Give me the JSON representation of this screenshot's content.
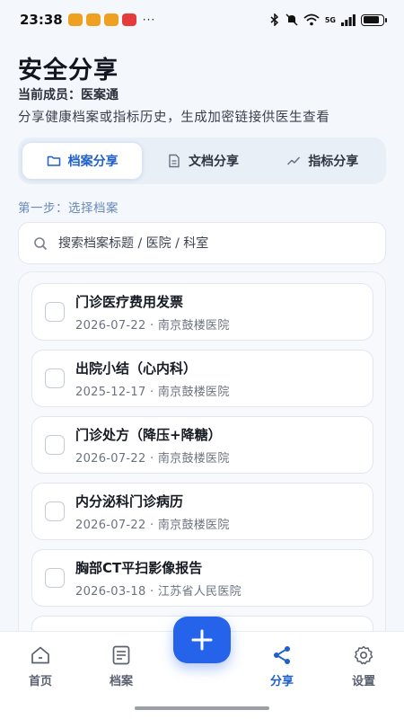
{
  "status_bar": {
    "time": "23:38",
    "more": "···",
    "signal_label": "5G",
    "battery_level": 0.85,
    "app_badges": [
      "#f0a020",
      "#f0a020",
      "#f0a020",
      "#e63b3b"
    ]
  },
  "header": {
    "title": "安全分享",
    "member_line": "当前成员：医案通",
    "subtitle": "分享健康档案或指标历史，生成加密链接供医生查看"
  },
  "tabs": [
    {
      "label": "档案分享",
      "icon": "folder-icon",
      "active": true
    },
    {
      "label": "文档分享",
      "icon": "document-icon",
      "active": false
    },
    {
      "label": "指标分享",
      "icon": "trend-icon",
      "active": false
    }
  ],
  "step_label": "第一步：选择档案",
  "search": {
    "placeholder": "搜索档案标题 / 医院 / 科室",
    "value": ""
  },
  "records": [
    {
      "title": "门诊医疗费用发票",
      "meta": "2026-07-22 · 南京鼓楼医院",
      "checked": false
    },
    {
      "title": "出院小结（心内科）",
      "meta": "2025-12-17 · 南京鼓楼医院",
      "checked": false
    },
    {
      "title": "门诊处方（降压+降糖）",
      "meta": "2026-07-22 · 南京鼓楼医院",
      "checked": false
    },
    {
      "title": "内分泌科门诊病历",
      "meta": "2026-07-22 · 南京鼓楼医院",
      "checked": false
    },
    {
      "title": "胸部CT平扫影像报告",
      "meta": "2026-03-18 · 江苏省人民医院",
      "checked": false
    },
    {
      "title": "",
      "meta": "",
      "checked": false
    }
  ],
  "fab": {
    "label": "+",
    "icon": "plus-icon"
  },
  "nav": [
    {
      "label": "首页",
      "icon": "home-icon",
      "active": false
    },
    {
      "label": "档案",
      "icon": "records-icon",
      "active": false
    },
    {
      "label": "分享",
      "icon": "share-icon",
      "active": true
    },
    {
      "label": "设置",
      "icon": "settings-icon",
      "active": false
    }
  ],
  "colors": {
    "accent": "#2563eb",
    "active_text": "#1f5fcc",
    "background": "#f4f7fb"
  }
}
